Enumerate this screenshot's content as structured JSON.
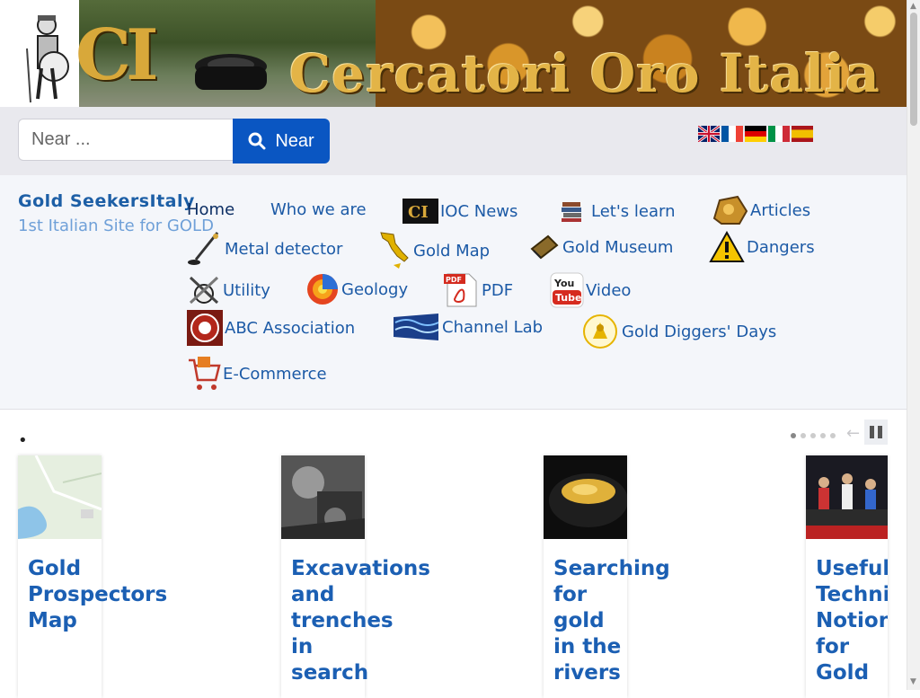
{
  "banner": {
    "logo_text": "CI",
    "title": "Cercatori Oro Italia"
  },
  "search": {
    "placeholder": "Near ...",
    "button_label": "Near",
    "icon": "search-icon"
  },
  "languages": [
    {
      "code": "en",
      "icon": "uk-flag-icon"
    },
    {
      "code": "fr",
      "icon": "france-flag-icon"
    },
    {
      "code": "de",
      "icon": "germany-flag-icon"
    },
    {
      "code": "it",
      "icon": "italy-flag-icon"
    },
    {
      "code": "es",
      "icon": "spain-flag-icon"
    }
  ],
  "brand": {
    "title": "Gold SeekersItaly",
    "subtitle": "1st Italian Site for GOLD"
  },
  "nav": {
    "home": "Home",
    "who_we_are": "Who we are",
    "ioc_news": "IOC News",
    "lets_learn": "Let's learn",
    "articles": "Articles",
    "metal_detector": "Metal detector",
    "gold_map": "Gold Map",
    "gold_museum": "Gold Museum",
    "dangers": "Dangers",
    "utility": "Utility",
    "geology": "Geology",
    "pdf": "PDF",
    "video": "Video",
    "abc_association": "ABC Association",
    "channel_lab": "Channel Lab",
    "gold_diggers_days": "Gold Diggers' Days",
    "e_commerce": "E-Commerce"
  },
  "carousel": {
    "marker": "•",
    "arrow": "←",
    "cards": [
      {
        "title": "Gold\nProspectors\nMap"
      },
      {
        "title": "Excavations\nand\ntrenches\nin\nsearch"
      },
      {
        "title": "Searching\nfor\ngold\nin the\nrivers"
      },
      {
        "title": "Useful\nTechnic\nNotions\nfor\nGold"
      }
    ]
  },
  "colors": {
    "accent": "#0a56c2",
    "link": "#1c5aa6",
    "card_title": "#1b5fb3"
  }
}
